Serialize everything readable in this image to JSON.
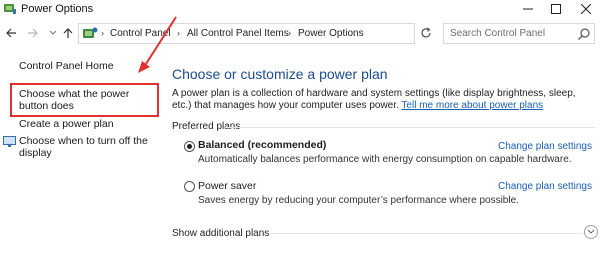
{
  "window": {
    "title": "Power Options",
    "controls": {
      "minimize": "minimize-icon",
      "maximize": "maximize-icon",
      "close": "close-icon"
    }
  },
  "address_bar": {
    "crumbs": [
      "Control Panel",
      "All Control Panel Items",
      "Power Options"
    ],
    "search_placeholder": "Search Control Panel"
  },
  "sidebar": {
    "home": "Control Panel Home",
    "items": [
      {
        "label": "Choose what the power button does"
      },
      {
        "label": "Create a power plan"
      },
      {
        "label": "Choose when to turn off the display"
      }
    ]
  },
  "main": {
    "heading": "Choose or customize a power plan",
    "description": "A power plan is a collection of hardware and system settings (like display brightness, sleep, etc.) that manages how your computer uses power.",
    "description_link": "Tell me more about power plans",
    "preferred_heading": "Preferred plans",
    "plans": [
      {
        "name": "Balanced (recommended)",
        "selected": true,
        "description": "Automatically balances performance with energy consumption on capable hardware.",
        "change_link": "Change plan settings"
      },
      {
        "name": "Power saver",
        "selected": false,
        "description": "Saves energy by reducing your computer’s performance where possible.",
        "change_link": "Change plan settings"
      }
    ],
    "show_additional": "Show additional plans"
  },
  "colors": {
    "heading": "#1c4d8c",
    "link": "#1a5fb4",
    "annotation": "#e03131"
  }
}
